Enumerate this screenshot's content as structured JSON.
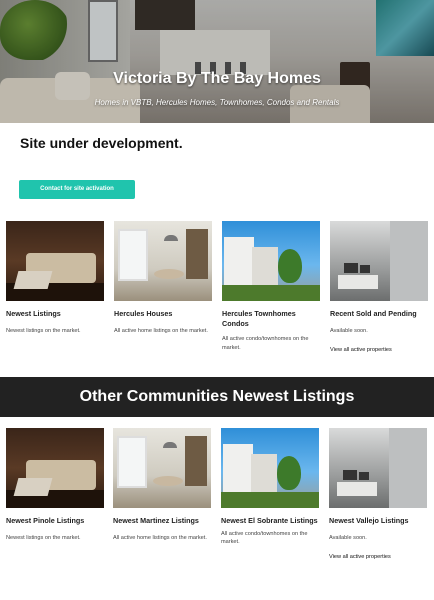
{
  "hero": {
    "title": "Victoria By The Bay Homes",
    "subtitle": "Homes in VBTB, Hercules Homes, Townhomes, Condos and Rentals"
  },
  "notice": "Site under development.",
  "cta_label": "Contact for site activation",
  "listings": [
    {
      "title": "Newest Listings",
      "text": "Newest listings on the market.",
      "link": ""
    },
    {
      "title": "Hercules Houses",
      "text": "All active home listings on the market.",
      "link": ""
    },
    {
      "title": "Hercules Townhomes Condos",
      "text": "All active condo/townhomes on the market.",
      "link": ""
    },
    {
      "title": "Recent Sold and Pending",
      "text": "Available soon.",
      "link": "View all active properties"
    }
  ],
  "section_title": "Other Communities Newest Listings",
  "communities": [
    {
      "title": "Newest  Pinole Listings",
      "text": "Newest listings on the market.",
      "link": ""
    },
    {
      "title": "Newest Martinez Listings",
      "text": "All active home listings on the market.",
      "link": ""
    },
    {
      "title": "Newest El Sobrante Listings",
      "text": "All active condo/townhomes on the market.",
      "link": ""
    },
    {
      "title": "Newest Vallejo Listings",
      "text": "Available soon.",
      "link": "View all active properties"
    }
  ]
}
